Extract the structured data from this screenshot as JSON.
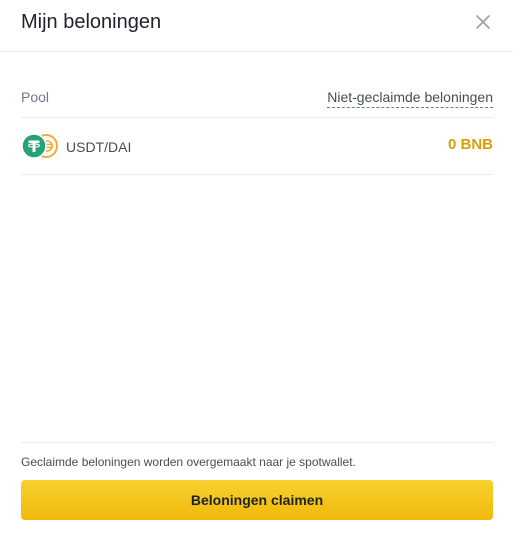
{
  "modal": {
    "title": "Mijn beloningen",
    "close_icon": "close-icon"
  },
  "table": {
    "col_pool": "Pool",
    "col_unclaimed": "Niet-geclaimde beloningen",
    "rows": [
      {
        "pair": "USDT/DAI",
        "amount": "0 BNB",
        "icons": [
          "usdt-token-icon",
          "dai-token-icon"
        ]
      }
    ]
  },
  "footer": {
    "note": "Geclaimde beloningen worden overgemaakt naar je spotwallet.",
    "claim_label": "Beloningen claimen"
  },
  "colors": {
    "accent": "#f0b90b",
    "amount": "#d89f00",
    "usdt": "#26a17b",
    "dai": "#f5ac37"
  }
}
